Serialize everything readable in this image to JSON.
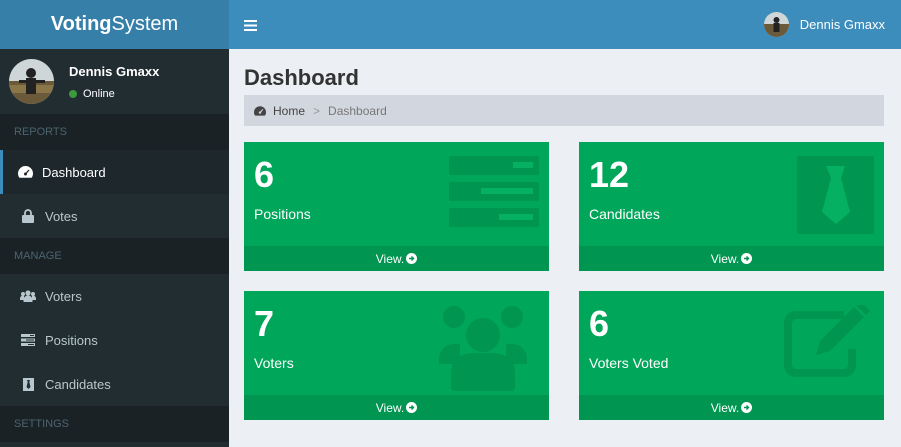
{
  "app": {
    "logo_bold": "Voting",
    "logo_rest": "System"
  },
  "user": {
    "name": "Dennis Gmaxx",
    "status": "Online"
  },
  "sidebar": {
    "reports_header": "REPORTS",
    "manage_header": "MANAGE",
    "settings_header": "SETTINGS",
    "items": [
      {
        "label": "Dashboard",
        "icon": "dashboard-icon"
      },
      {
        "label": "Votes",
        "icon": "lock-icon"
      },
      {
        "label": "Voters",
        "icon": "users-icon"
      },
      {
        "label": "Positions",
        "icon": "tasks-icon"
      },
      {
        "label": "Candidates",
        "icon": "tie-icon"
      }
    ]
  },
  "main": {
    "title": "Dashboard",
    "breadcrumb": {
      "home": "Home",
      "current": "Dashboard"
    },
    "boxes": [
      {
        "value": "6",
        "label": "Positions",
        "footer": "View.",
        "icon": "tasks-icon"
      },
      {
        "value": "12",
        "label": "Candidates",
        "footer": "View.",
        "icon": "tie-icon"
      },
      {
        "value": "7",
        "label": "Voters",
        "footer": "View.",
        "icon": "users-icon"
      },
      {
        "value": "6",
        "label": "Voters Voted",
        "footer": "View.",
        "icon": "edit-icon"
      }
    ]
  },
  "colors": {
    "green": "#00a65a",
    "blue": "#3c8dbc",
    "sidebar": "#222d32"
  }
}
